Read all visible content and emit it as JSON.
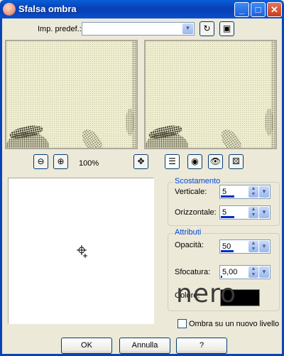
{
  "window": {
    "title": "Sfalsa ombra"
  },
  "titlebar_buttons": {
    "minimize": "_",
    "maximize": "□",
    "close": "✕"
  },
  "preset": {
    "label": "Imp. predef.:",
    "value": ""
  },
  "zoom": {
    "level": "100%"
  },
  "offset_group": {
    "title": "Scostamento",
    "vertical": {
      "label": "Verticale:",
      "value": "5",
      "level_percent": 52
    },
    "horizontal": {
      "label": "Orizzontale:",
      "value": "5",
      "level_percent": 52
    }
  },
  "attributes_group": {
    "title": "Attributi",
    "opacity": {
      "label": "Opacità:",
      "value": "50",
      "level_percent": 50
    },
    "blur": {
      "label": "Sfocatura:",
      "value": "5,00",
      "level_percent": 5
    },
    "color": {
      "label": "Colore:",
      "value": "#000000"
    }
  },
  "watermark": {
    "text": "nero"
  },
  "new_layer_checkbox": {
    "label": "Ombra su un nuovo livello",
    "checked": false
  },
  "buttons": {
    "ok": "OK",
    "cancel": "Annulla",
    "help": "?"
  }
}
